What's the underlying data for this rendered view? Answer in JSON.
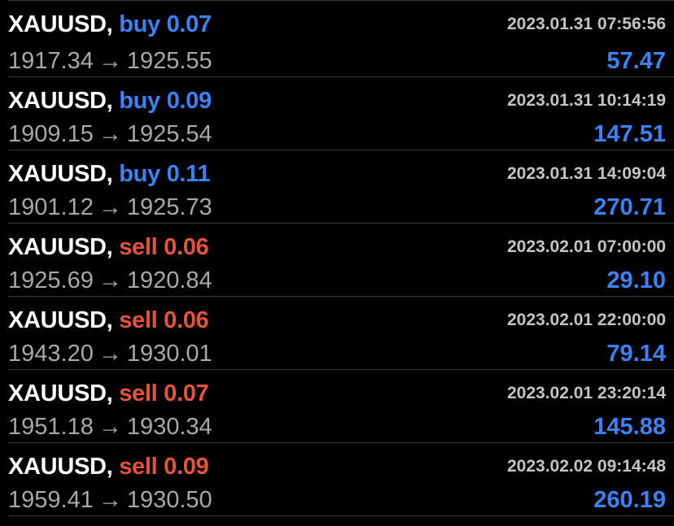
{
  "colors": {
    "background": "#000000",
    "buy": "#3b82f6",
    "sell": "#e5533d",
    "profit": "#3b82f6",
    "symbol": "#ffffff",
    "muted": "#a8a8a8"
  },
  "arrow": "→",
  "trades": [
    {
      "symbol": "XAUUSD,",
      "side": "buy 0.07",
      "type": "buy",
      "time": "2023.01.31 07:56:56",
      "open": "1917.34",
      "close": "1925.55",
      "profit": "57.47"
    },
    {
      "symbol": "XAUUSD,",
      "side": "buy 0.09",
      "type": "buy",
      "time": "2023.01.31 10:14:19",
      "open": "1909.15",
      "close": "1925.54",
      "profit": "147.51"
    },
    {
      "symbol": "XAUUSD,",
      "side": "buy 0.11",
      "type": "buy",
      "time": "2023.01.31 14:09:04",
      "open": "1901.12",
      "close": "1925.73",
      "profit": "270.71"
    },
    {
      "symbol": "XAUUSD,",
      "side": "sell 0.06",
      "type": "sell",
      "time": "2023.02.01 07:00:00",
      "open": "1925.69",
      "close": "1920.84",
      "profit": "29.10"
    },
    {
      "symbol": "XAUUSD,",
      "side": "sell 0.06",
      "type": "sell",
      "time": "2023.02.01 22:00:00",
      "open": "1943.20",
      "close": "1930.01",
      "profit": "79.14"
    },
    {
      "symbol": "XAUUSD,",
      "side": "sell 0.07",
      "type": "sell",
      "time": "2023.02.01 23:20:14",
      "open": "1951.18",
      "close": "1930.34",
      "profit": "145.88"
    },
    {
      "symbol": "XAUUSD,",
      "side": "sell 0.09",
      "type": "sell",
      "time": "2023.02.02 09:14:48",
      "open": "1959.41",
      "close": "1930.50",
      "profit": "260.19"
    }
  ]
}
